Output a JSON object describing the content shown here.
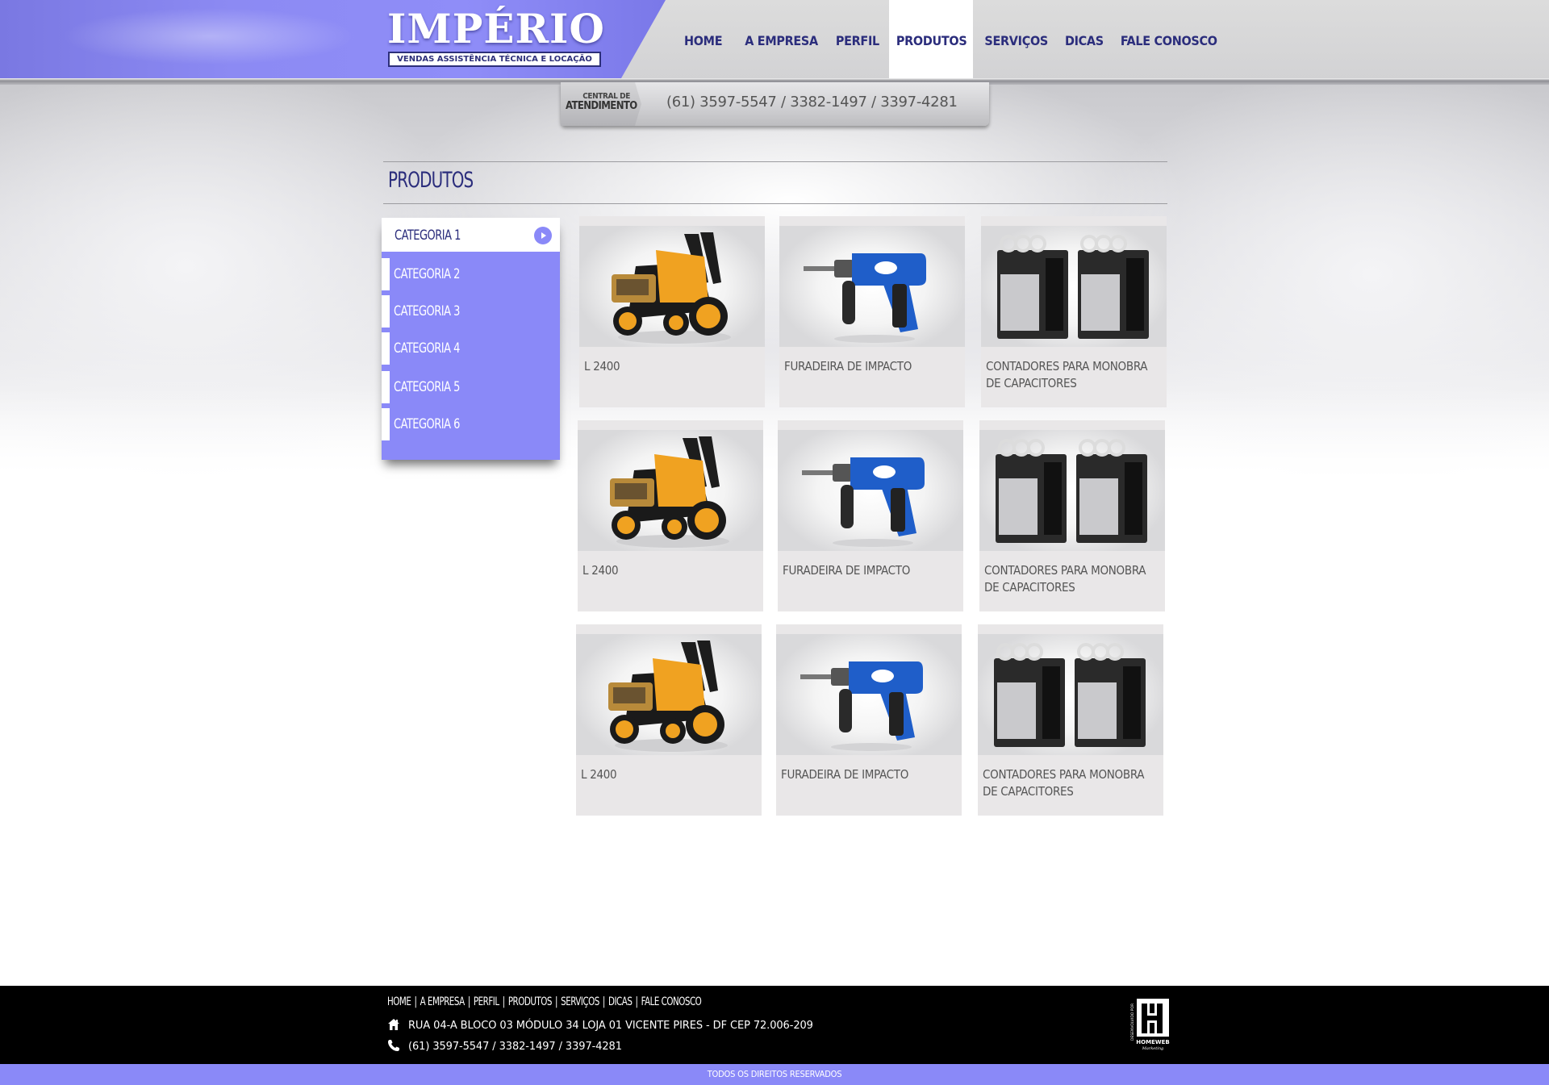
{
  "brand": {
    "name": "IMPÉRIO",
    "tagline": "VENDAS ASSISTÊNCIA TÉCNICA E LOCAÇÃO",
    "accent_color": "#8a89f8",
    "dark_color": "#2b2d7c"
  },
  "nav": {
    "items": [
      {
        "label": "HOME"
      },
      {
        "label": "A EMPRESA"
      },
      {
        "label": "PERFIL"
      },
      {
        "label": "PRODUTOS"
      },
      {
        "label": "SERVIÇOS"
      },
      {
        "label": "DICAS"
      },
      {
        "label": "FALE CONOSCO"
      }
    ],
    "active": "PRODUTOS"
  },
  "call_center": {
    "label_line1": "CENTRAL DE",
    "label_line2": "ATENDIMENTO",
    "phones": "(61) 3597-5547 / 3382-1497 / 3397-4281"
  },
  "page": {
    "title": "PRODUTOS"
  },
  "sidebar": {
    "categories": [
      {
        "label": "CATEGORIA 1",
        "active": true
      },
      {
        "label": "CATEGORIA 2",
        "active": false
      },
      {
        "label": "CATEGORIA 3",
        "active": false
      },
      {
        "label": "CATEGORIA 4",
        "active": false
      },
      {
        "label": "CATEGORIA 5",
        "active": false
      },
      {
        "label": "CATEGORIA 6",
        "active": false
      }
    ]
  },
  "products": [
    {
      "name": "L 2400",
      "image": "pressure-washer-icon"
    },
    {
      "name": "FURADEIRA DE IMPACTO",
      "image": "impact-drill-icon"
    },
    {
      "name": "CONTADORES PARA MONOBRA DE CAPACITORES",
      "image": "capacitor-contactor-icon"
    },
    {
      "name": "L 2400",
      "image": "pressure-washer-icon"
    },
    {
      "name": "FURADEIRA DE IMPACTO",
      "image": "impact-drill-icon"
    },
    {
      "name": "CONTADORES PARA MONOBRA DE CAPACITORES",
      "image": "capacitor-contactor-icon"
    },
    {
      "name": "L 2400",
      "image": "pressure-washer-icon"
    },
    {
      "name": "FURADEIRA DE IMPACTO",
      "image": "impact-drill-icon"
    },
    {
      "name": "CONTADORES PARA MONOBRA DE CAPACITORES",
      "image": "capacitor-contactor-icon"
    }
  ],
  "footer": {
    "nav": [
      "HOME",
      "A EMPRESA",
      "PERFIL",
      "PRODUTOS",
      "SERVIÇOS",
      "DICAS",
      "FALE CONOSCO"
    ],
    "address_icon": "home-icon",
    "address": "RUA 04-A BLOCO 03 MÓDULO 34 LOJA 01 VICENTE PIRES - DF CEP 72.006-209",
    "phone_icon": "phone-icon",
    "phones": "(61) 3597-5547 / 3382-1497 / 3397-4281",
    "developer_logo": "homeweb-logo",
    "developer_caption": "DESENVOLVIDO POR",
    "developer_name": "HOMEWEB",
    "developer_sub": "Marketing",
    "copyright": "TODOS OS DIREITOS RESERVADOS"
  }
}
